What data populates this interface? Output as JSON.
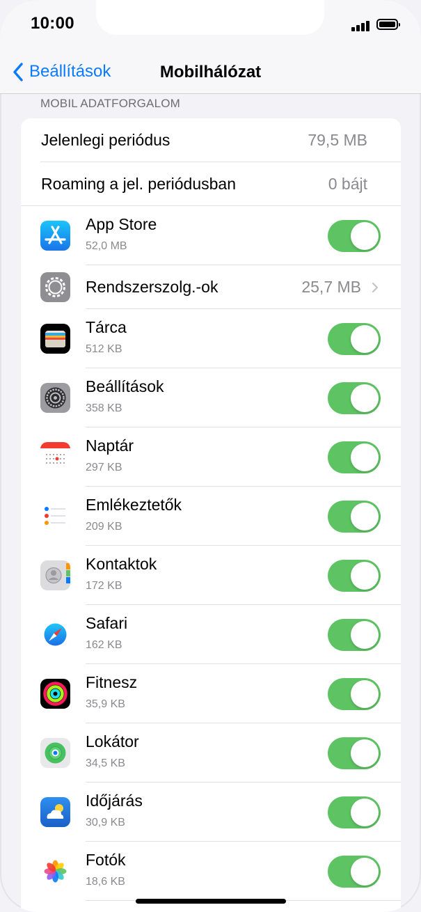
{
  "status_bar": {
    "time": "10:00"
  },
  "nav": {
    "back_label": "Beállítások",
    "title": "Mobilhálózat"
  },
  "section_header": "MOBIL ADATFORGALOM",
  "summary_rows": [
    {
      "label": "Jelenlegi periódus",
      "value": "79,5 MB"
    },
    {
      "label": "Roaming a jel. periódusban",
      "value": "0 bájt"
    }
  ],
  "apps": [
    {
      "name": "App Store",
      "size": "52,0 MB",
      "icon": "app-store-icon",
      "enabled": true
    },
    {
      "name": "Rendszerszolg.-ok",
      "size": "25,7 MB",
      "icon": "system-services-icon"
    },
    {
      "name": "Tárca",
      "size": "512 KB",
      "icon": "wallet-icon",
      "enabled": true
    },
    {
      "name": "Beállítások",
      "size": "358 KB",
      "icon": "settings-icon",
      "enabled": true
    },
    {
      "name": "Naptár",
      "size": "297 KB",
      "icon": "calendar-icon",
      "enabled": true
    },
    {
      "name": "Emlékeztetők",
      "size": "209 KB",
      "icon": "reminders-icon",
      "enabled": true
    },
    {
      "name": "Kontaktok",
      "size": "172 KB",
      "icon": "contacts-icon",
      "enabled": true
    },
    {
      "name": "Safari",
      "size": "162 KB",
      "icon": "safari-icon",
      "enabled": true
    },
    {
      "name": "Fitnesz",
      "size": "35,9 KB",
      "icon": "fitness-icon",
      "enabled": true
    },
    {
      "name": "Lokátor",
      "size": "34,5 KB",
      "icon": "find-my-icon",
      "enabled": true
    },
    {
      "name": "Időjárás",
      "size": "30,9 KB",
      "icon": "weather-icon",
      "enabled": true
    },
    {
      "name": "Fotók",
      "size": "18,6 KB",
      "icon": "photos-icon",
      "enabled": true
    }
  ],
  "colors": {
    "accent": "#0a7aff",
    "toggle_on": "#5ec463",
    "background": "#f2f2f7"
  }
}
